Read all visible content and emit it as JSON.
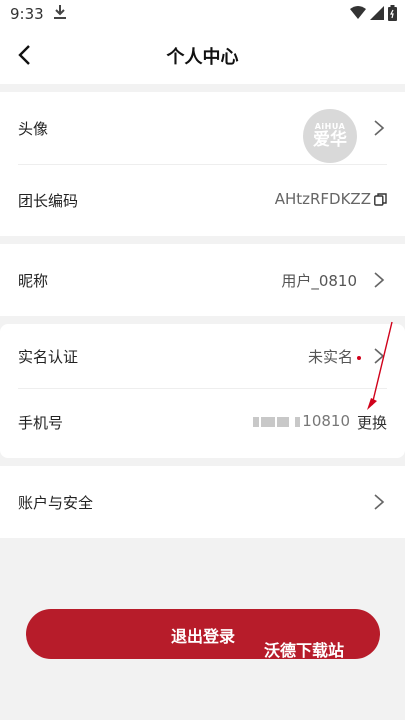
{
  "status": {
    "time": "9:33"
  },
  "header": {
    "title": "个人中心"
  },
  "rows": {
    "avatar": {
      "label": "头像",
      "logo_top": "AiHUA",
      "logo_main": "爱华"
    },
    "code": {
      "label": "团长编码",
      "value": "AHtzRFDKZZ"
    },
    "nickname": {
      "label": "昵称",
      "value": "用户_0810"
    },
    "realname": {
      "label": "实名认证",
      "value": "未实名"
    },
    "phone": {
      "label": "手机号",
      "value": "10810",
      "action": "更换"
    },
    "security": {
      "label": "账户与安全"
    }
  },
  "logout": {
    "label": "退出登录"
  },
  "watermark": "沃德下载站",
  "colors": {
    "accent": "#b71c2a",
    "background": "#f2f2f2"
  }
}
